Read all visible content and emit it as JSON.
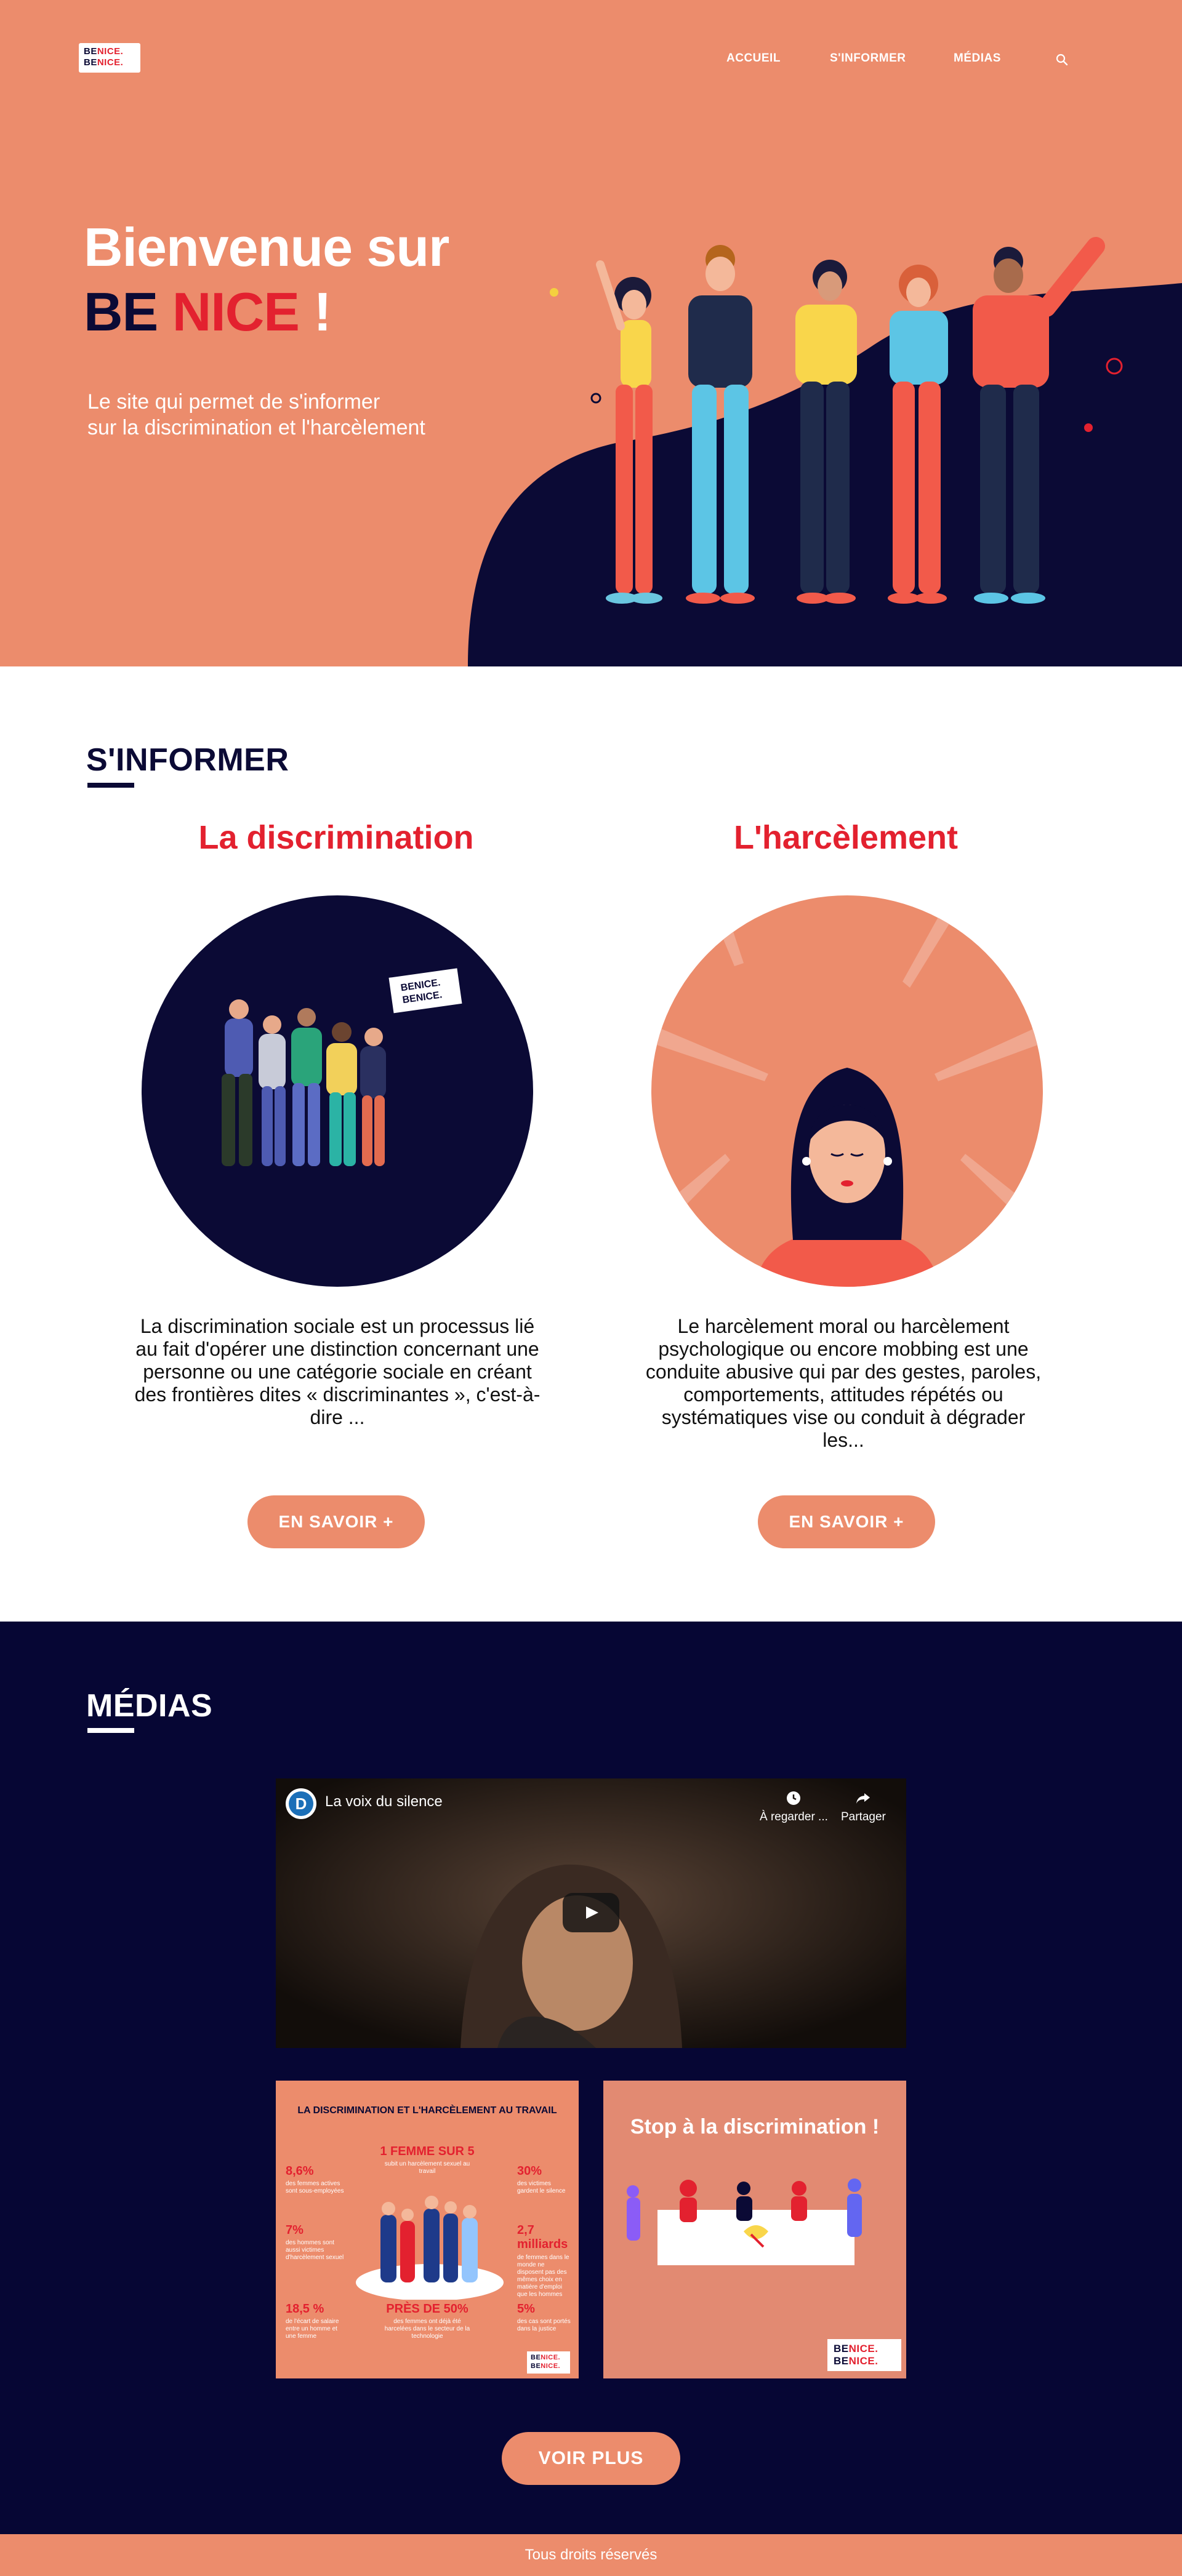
{
  "brand": {
    "logo_line1_a": "BE",
    "logo_line1_b": "NICE.",
    "logo_line2_a": "BE",
    "logo_line2_b": "NICE."
  },
  "nav": {
    "items": [
      "ACCUEIL",
      "S'INFORMER",
      "MÉDIAS"
    ],
    "search_icon": "search-icon"
  },
  "hero": {
    "title_line1": "Bienvenue sur",
    "title_be": "BE",
    "title_nice": "NICE",
    "title_bang": "!",
    "subtitle_line1": "Le site qui permet de s'informer",
    "subtitle_line2": "sur la discrimination et l'harcèlement"
  },
  "informer": {
    "title": "S'INFORMER",
    "cards": [
      {
        "title": "La discrimination",
        "text": "La discrimination sociale est un processus lié au fait d'opérer une distinction concernant une personne ou une catégorie sociale en créant des frontières dites « discriminantes », c'est-à-dire ...",
        "button": "EN SAVOIR +"
      },
      {
        "title": "L'harcèlement",
        "text": "Le harcèlement moral ou harcèlement psychologique ou encore mobbing est une conduite abusive qui par des gestes, paroles, comportements, attitudes répétés ou systématiques vise ou conduit à dégrader les...",
        "button": "EN SAVOIR +"
      }
    ],
    "sign_line1": "BENICE.",
    "sign_line2": "BENICE."
  },
  "medias": {
    "title": "MÉDIAS",
    "video": {
      "channel_letter": "D",
      "title": "La voix du silence",
      "watch_later": "À regarder ...",
      "share": "Partager"
    },
    "infographic": {
      "heading": "LA DISCRIMINATION ET L'HARCÈLEMENT AU TRAVAIL",
      "stats": [
        {
          "num": "8,6%",
          "txt": "des femmes actives sont sous-employées"
        },
        {
          "num": "1 FEMME SUR 5",
          "txt": "subit un harcèlement sexuel au travail"
        },
        {
          "num": "30%",
          "txt": "des victimes gardent le silence"
        },
        {
          "num": "7%",
          "txt": "des hommes sont aussi victimes d'harcèlement sexuel"
        },
        {
          "num": "2,7 milliards",
          "txt": "de femmes dans le monde ne disposent pas des mêmes choix en matière d'emploi que les hommes"
        },
        {
          "num": "18,5 %",
          "txt": "de l'écart de salaire entre un homme et une femme"
        },
        {
          "num": "PRÈS DE 50%",
          "txt": "des femmes ont déjà été harcelées dans le secteur de la technologie"
        },
        {
          "num": "5%",
          "txt": "des cas sont portés dans la justice"
        }
      ]
    },
    "poster": {
      "title": "Stop à la discrimination !"
    },
    "more_button": "VOIR PLUS"
  },
  "footer": {
    "text": "Tous droits réservés"
  },
  "colors": {
    "salmon": "#ec8c6c",
    "navy": "#0b0a35",
    "red": "#e3212f",
    "deep_navy": "#060634"
  }
}
